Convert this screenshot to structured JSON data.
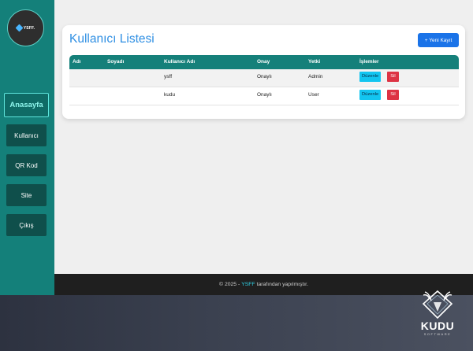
{
  "sidebar": {
    "logo_text": "YSFF.",
    "items": [
      {
        "label": "Anasayfa",
        "active": true
      },
      {
        "label": "Kullanıcı"
      },
      {
        "label": "QR Kod"
      },
      {
        "label": "Site"
      },
      {
        "label": "Çıkış"
      }
    ]
  },
  "main": {
    "title": "Kullanıcı Listesi",
    "add_button": "+ Yeni Kayıt",
    "table": {
      "headers": [
        "Adı",
        "Soyadı",
        "Kullanıcı Adı",
        "Onay",
        "Yetki",
        "İşlemler"
      ],
      "rows": [
        {
          "ad": "",
          "soyad": "",
          "kullanici_adi": "ysff",
          "onay": "Onaylı",
          "yetki": "Admin",
          "edit": "Düzenle",
          "delete": "Sil"
        },
        {
          "ad": "",
          "soyad": "",
          "kullanici_adi": "kudu",
          "onay": "Onaylı",
          "yetki": "User",
          "edit": "Düzenle",
          "delete": "Sil"
        }
      ]
    }
  },
  "footer": {
    "prefix": "© 2025 -",
    "brand": "YSFF",
    "suffix": "tarafından yapılmıştır."
  },
  "watermark": {
    "word": "KUDU",
    "sub": "SOFTWARE"
  },
  "colors": {
    "sidebar": "#14807a",
    "accent": "#1a73e8",
    "header": "#15807a",
    "edit": "#13c5f0",
    "delete": "#dd3344"
  }
}
